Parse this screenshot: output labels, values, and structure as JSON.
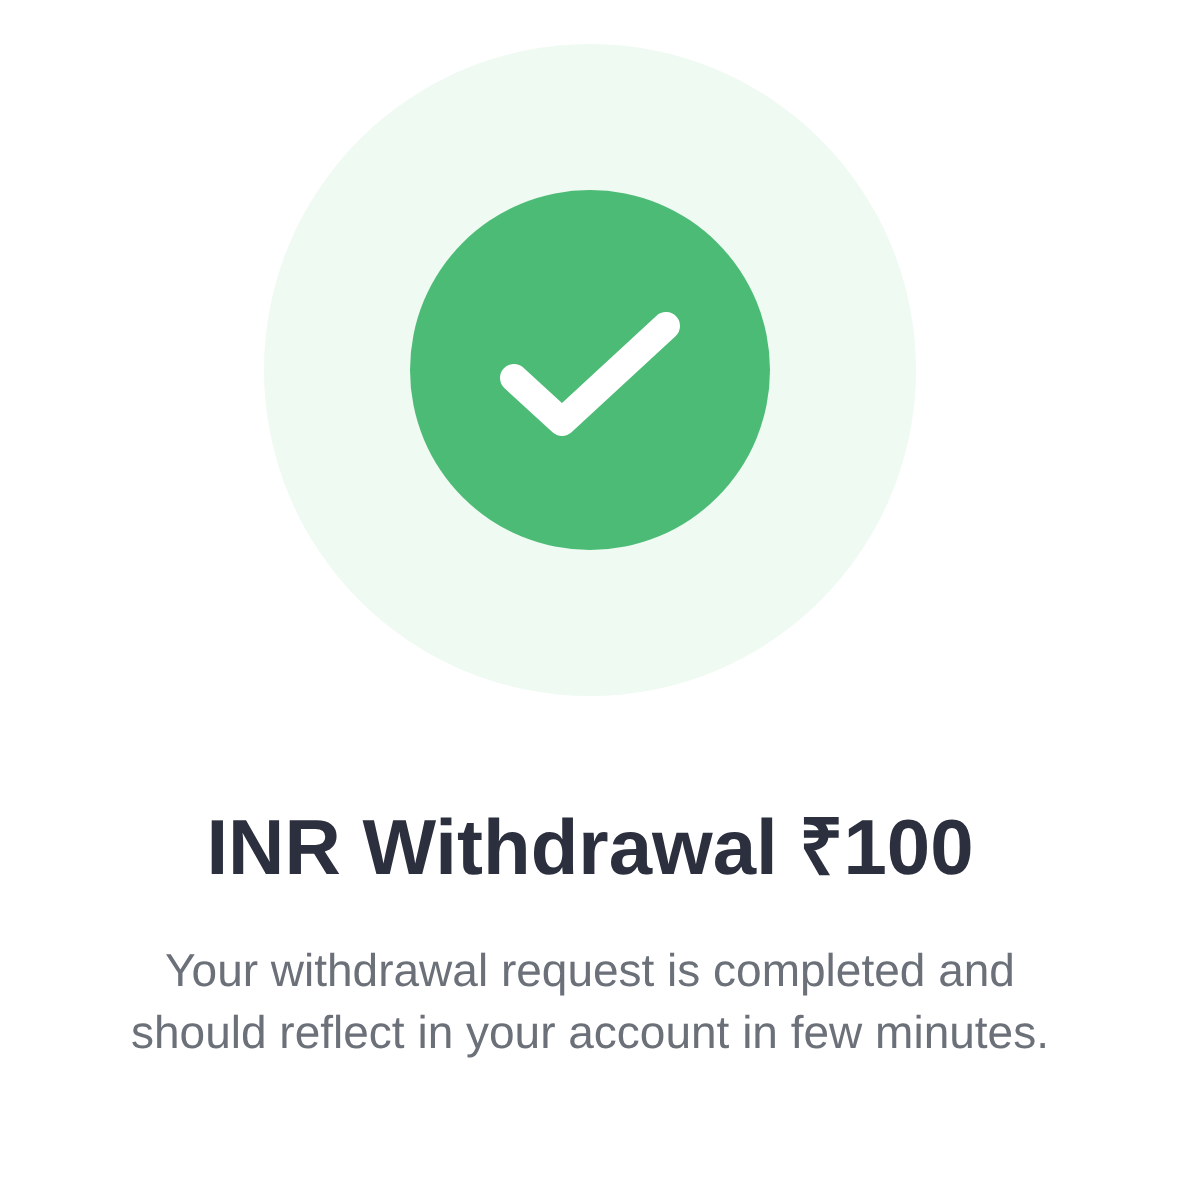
{
  "title": "INR Withdrawal ₹100",
  "message": "Your withdrawal request is completed and should reflect in your account in few minutes."
}
